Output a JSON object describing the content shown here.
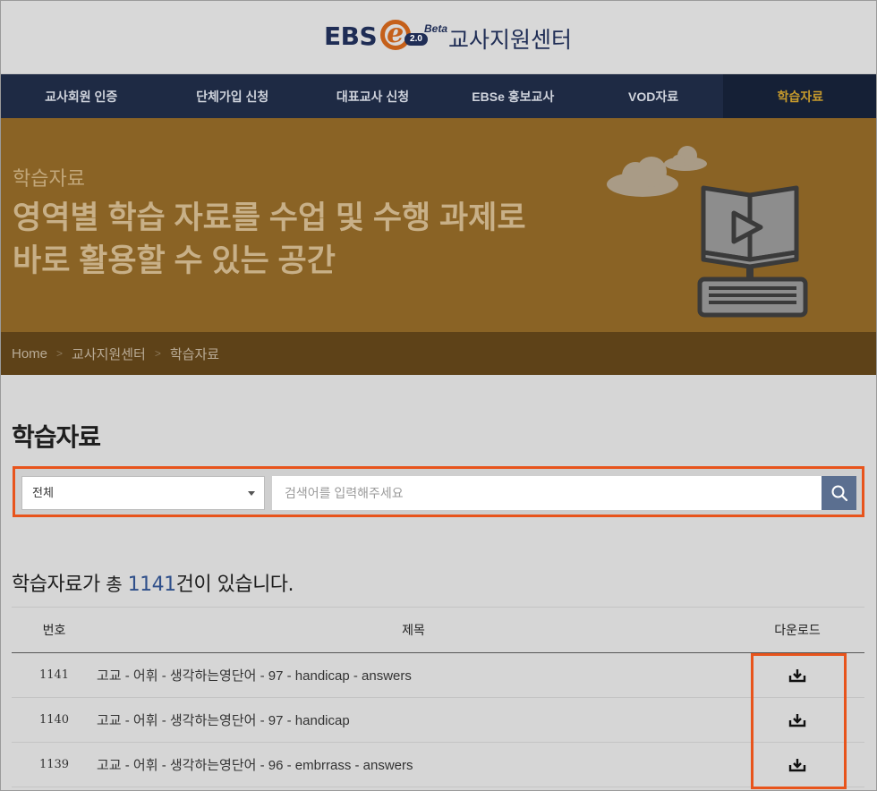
{
  "header": {
    "logo_ebs": "EBS",
    "logo_e": "e",
    "logo_version": "2.0",
    "logo_beta": "Beta",
    "site_title": "교사지원센터"
  },
  "nav": {
    "items": [
      {
        "label": "교사회원 인증"
      },
      {
        "label": "단체가입 신청"
      },
      {
        "label": "대표교사 신청"
      },
      {
        "label": "EBSe 홍보교사"
      },
      {
        "label": "VOD자료"
      },
      {
        "label": "학습자료",
        "active": true
      }
    ],
    "active_color": "#c69a2c"
  },
  "hero": {
    "subtitle": "학습자료",
    "title_line1": "영역별 학습 자료를 수업 및 수행 과제로",
    "title_line2": "바로 활용할 수 있는 공간",
    "background_color": "#8a6325",
    "illustration_icon": "book-video-keyboard-icon"
  },
  "breadcrumb": {
    "items": [
      "Home",
      "교사지원센터",
      "학습자료"
    ],
    "separator": ">"
  },
  "section": {
    "title": "학습자료"
  },
  "search": {
    "select_value": "전체",
    "placeholder": "검색어를 입력해주세요",
    "button_icon": "search-icon",
    "highlight_color": "#e8541c"
  },
  "summary": {
    "prefix": "학습자료가",
    "mid": "총",
    "count": "1141",
    "suffix": "건이 있습니다."
  },
  "table": {
    "headers": {
      "no": "번호",
      "title": "제목",
      "download": "다운로드"
    },
    "rows": [
      {
        "no": "1141",
        "title": "고교 - 어휘 - 생각하는영단어 - 97 - handicap - answers"
      },
      {
        "no": "1140",
        "title": "고교 - 어휘 - 생각하는영단어 - 97 - handicap"
      },
      {
        "no": "1139",
        "title": "고교 - 어휘 - 생각하는영단어 - 96 - embrrass - answers"
      }
    ],
    "download_icon": "download-icon"
  }
}
